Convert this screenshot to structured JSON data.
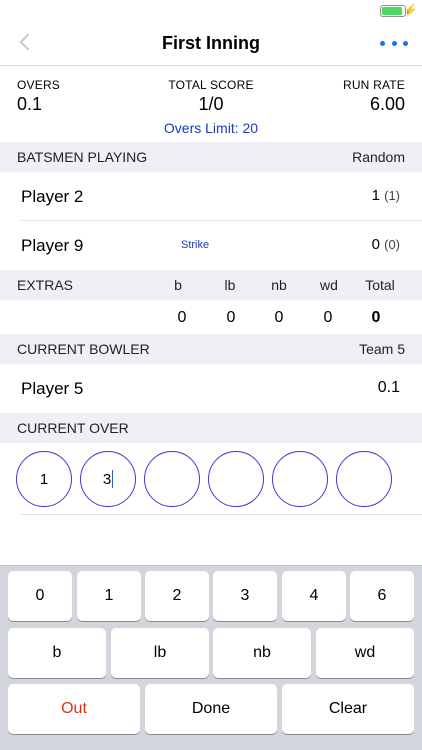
{
  "status": {
    "battery_level": 0.9,
    "battery_color": "#4cd964"
  },
  "nav": {
    "title": "First Inning"
  },
  "score": {
    "overs_label": "OVERS",
    "overs_value": "0.1",
    "total_label": "TOTAL SCORE",
    "total_value": "1/0",
    "rate_label": "RUN RATE",
    "rate_value": "6.00",
    "overs_limit": "Overs Limit: 20"
  },
  "batsmen": {
    "header": "BATSMEN PLAYING",
    "mode": "Random",
    "players": [
      {
        "name": "Player 2",
        "runs": "1",
        "balls": "(1)",
        "strike": ""
      },
      {
        "name": "Player 9",
        "runs": "0",
        "balls": "(0)",
        "strike": "Strike"
      }
    ]
  },
  "extras": {
    "header": "EXTRAS",
    "columns": [
      "b",
      "lb",
      "nb",
      "wd",
      "Total"
    ],
    "values": [
      "0",
      "0",
      "0",
      "0",
      "0"
    ]
  },
  "bowler": {
    "header": "CURRENT BOWLER",
    "team": "Team 5",
    "name": "Player 5",
    "overs": "0.1"
  },
  "current_over": {
    "header": "CURRENT OVER",
    "balls": [
      "1",
      "3",
      "",
      "",
      "",
      ""
    ]
  },
  "keypad": {
    "row1": [
      "0",
      "1",
      "2",
      "3",
      "4",
      "6"
    ],
    "row2": [
      "b",
      "lb",
      "nb",
      "wd"
    ],
    "row3": [
      "Out",
      "Done",
      "Clear"
    ]
  },
  "colors": {
    "accent": "#1a3bb3",
    "out": "#e0301e",
    "ball_border": "#3b3bd6"
  }
}
